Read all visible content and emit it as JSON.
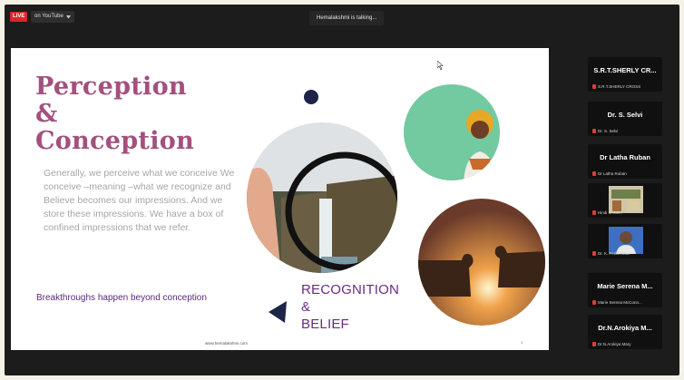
{
  "topbar": {
    "live_label": "LIVE",
    "stream_label": "on YouTube",
    "talking_indicator": "Hemalakshmi is talking..."
  },
  "slide": {
    "title_lines": [
      "Perception",
      "&",
      "Conception"
    ],
    "body": "Generally, we  perceive what we conceive We conceive –meaning –what we recognize and Believe becomes our impressions. And we store these impressions. We have a box of confined impressions that we refer.",
    "tagline": "Breakthroughs happen beyond conception",
    "keywords": [
      "RECOGNITION",
      "&",
      "BELIEF"
    ],
    "url": "www.hemalakshmi.com",
    "page_number": "1"
  },
  "participants": [
    {
      "name": "S.R.T.SHERLY  CR...",
      "caption": "S.R.T.SHERLY CROSS",
      "video": false
    },
    {
      "name": "Dr. S. Selvi",
      "caption": "Dr. S. Selvi",
      "video": false
    },
    {
      "name": "Dr Latha Ruban",
      "caption": "Dr Latha Ruban",
      "video": false
    },
    {
      "name": "",
      "caption": "Hindi SANS...",
      "video": true
    },
    {
      "name": "",
      "caption": "Dr. K. Ferial Khan",
      "video": true
    },
    {
      "name": "Marie Serena  M...",
      "caption": "Marie Serena McConn...",
      "video": false
    },
    {
      "name": "Dr.N.Arokiya  M...",
      "caption": "Dr.N.Arokiya Mary",
      "video": false
    }
  ],
  "colors": {
    "title": "#a3507e",
    "keywords": "#6b2a84",
    "live": "#d8262a"
  }
}
